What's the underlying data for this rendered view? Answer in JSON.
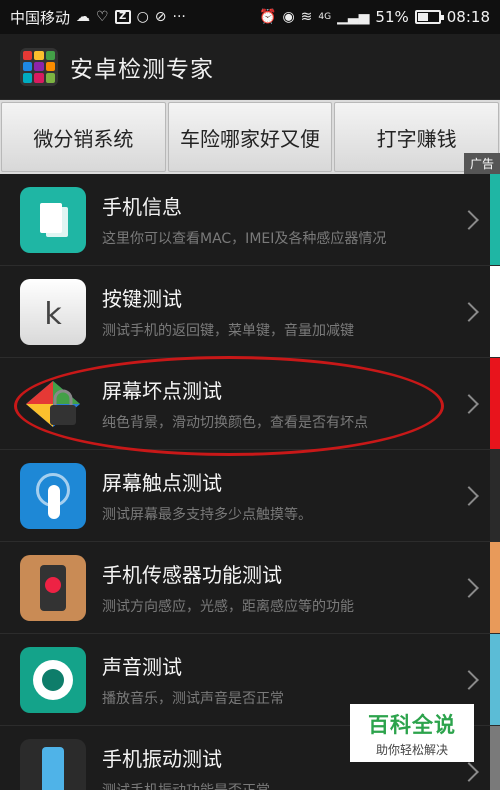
{
  "status_bar": {
    "carrier": "中国移动",
    "network": "4G",
    "battery": "51%",
    "battery_fraction": 0.51,
    "time": "08:18",
    "z_badge": "Z",
    "more_indicator": "···"
  },
  "app_bar": {
    "title": "安卓检测专家",
    "logo_colors": [
      "#e53935",
      "#fbc02d",
      "#43a047",
      "#1e88e5",
      "#8e24aa",
      "#fb8c00",
      "#00acc1",
      "#d81b60",
      "#7cb342"
    ]
  },
  "ad_bar": {
    "buttons": [
      "微分销系统",
      "车险哪家好又便",
      "打字赚钱"
    ],
    "ad_label": "广告"
  },
  "list_items": [
    {
      "title": "手机信息",
      "desc": "这里你可以查看MAC，IMEI及各种感应器情况",
      "icon": "phone-info-icon",
      "stripe": "#1fb6a4"
    },
    {
      "title": "按键测试",
      "desc": "测试手机的返回键，菜单键，音量加减键",
      "icon": "keyboard-key-icon",
      "stripe": "#ffffff"
    },
    {
      "title": "屏幕坏点测试",
      "desc": "纯色背景，滑动切换颜色，查看是否有坏点",
      "icon": "screen-dead-pixel-icon",
      "stripe": "#e8141c"
    },
    {
      "title": "屏幕触点测试",
      "desc": "测试屏幕最多支持多少点触摸等。",
      "icon": "touch-point-icon",
      "stripe": "#2a2a2a"
    },
    {
      "title": "手机传感器功能测试",
      "desc": "测试方向感应，光感，距离感应等的功能",
      "icon": "sensor-icon",
      "stripe": "#e89a5a"
    },
    {
      "title": "声音测试",
      "desc": "播放音乐，测试声音是否正常",
      "icon": "sound-icon",
      "stripe": "#5bbcd6"
    },
    {
      "title": "手机振动测试",
      "desc": "测试手机振动功能是否正常",
      "icon": "vibration-icon",
      "stripe": "#7a7a7a"
    }
  ],
  "watermark": {
    "title": "百科全说",
    "subtitle": "助你轻松解决"
  }
}
